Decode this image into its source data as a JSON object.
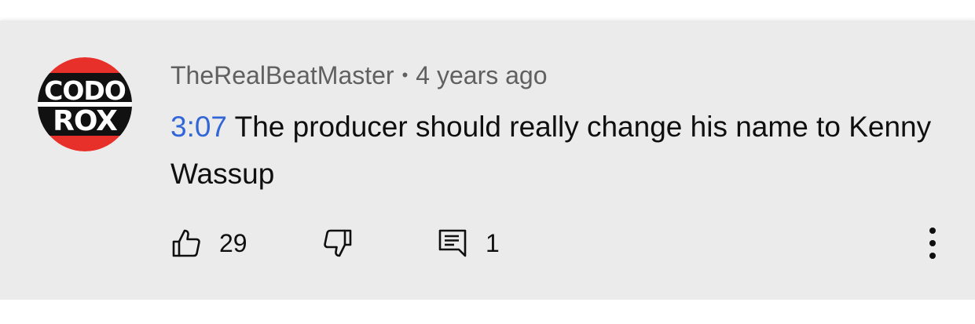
{
  "comment": {
    "author": "TheRealBeatMaster",
    "separator": "•",
    "posted": "4 years ago",
    "timestamp_link": "3:07",
    "text": " The producer should really change his name to Kenny Wassup",
    "avatar": {
      "line1": "CODO",
      "line2": "ROX",
      "colors": {
        "ring": "#e8302a",
        "band": "#111111",
        "text": "#ffffff"
      }
    }
  },
  "actions": {
    "like_count": "29",
    "reply_count": "1",
    "icons": [
      "thumb-up-icon",
      "thumb-down-icon",
      "reply-icon",
      "more-vert-icon"
    ]
  },
  "colors": {
    "card_bg": "#ebebeb",
    "link": "#3166d8",
    "meta_text": "#606060",
    "body_text": "#0f0f0f"
  }
}
